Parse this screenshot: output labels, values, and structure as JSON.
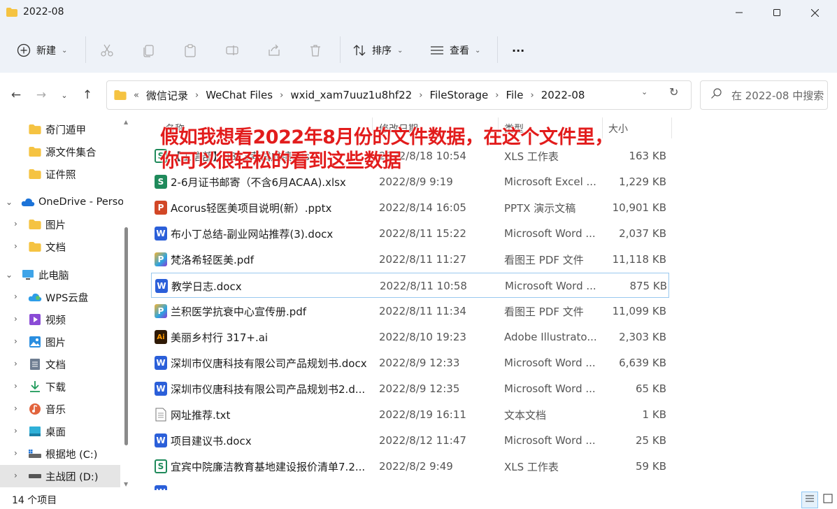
{
  "window": {
    "title": "2022-08"
  },
  "toolbar": {
    "new_label": "新建",
    "sort_label": "排序",
    "view_label": "查看",
    "more_label": "···"
  },
  "address": {
    "overflow": "«",
    "crumbs": [
      "微信记录",
      "WeChat Files",
      "wxid_xam7uuz1u8hf22",
      "FileStorage",
      "File",
      "2022-08"
    ],
    "search_placeholder": "在 2022-08 中搜索"
  },
  "sidebar": {
    "items": [
      {
        "label": "奇门遁甲",
        "icon": "folder-icon"
      },
      {
        "label": "源文件集合",
        "icon": "folder-icon"
      },
      {
        "label": "证件照",
        "icon": "folder-icon"
      },
      {
        "label": "OneDrive - Perso",
        "icon": "cloud-icon"
      },
      {
        "label": "图片",
        "icon": "folder-icon"
      },
      {
        "label": "文档",
        "icon": "folder-icon"
      },
      {
        "label": "此电脑",
        "icon": "computer-icon"
      },
      {
        "label": "WPS云盘",
        "icon": "wps-cloud-icon"
      },
      {
        "label": "视频",
        "icon": "video-icon"
      },
      {
        "label": "图片",
        "icon": "picture-icon"
      },
      {
        "label": "文档",
        "icon": "document-icon"
      },
      {
        "label": "下载",
        "icon": "download-icon"
      },
      {
        "label": "音乐",
        "icon": "music-icon"
      },
      {
        "label": "桌面",
        "icon": "desktop-icon"
      },
      {
        "label": "根据地 (C:)",
        "icon": "windows-drive-icon"
      },
      {
        "label": "主战团 (D:)",
        "icon": "drive-icon"
      }
    ]
  },
  "columns": {
    "name": "名称",
    "date": "修改日期",
    "type": "类型",
    "size": "大小"
  },
  "files": [
    {
      "name": "【工信部】0813考试成绩.xls",
      "date": "2022/8/18 10:54",
      "type": "XLS 工作表",
      "size": "163 KB",
      "icon": "xls"
    },
    {
      "name": "2-6月证书邮寄（不含6月ACAA).xlsx",
      "date": "2022/8/9 9:19",
      "type": "Microsoft Excel ...",
      "size": "1,229 KB",
      "icon": "xlsx"
    },
    {
      "name": "Acorus轻医美项目说明(新）.pptx",
      "date": "2022/8/14 16:05",
      "type": "PPTX 演示文稿",
      "size": "10,901 KB",
      "icon": "pptx"
    },
    {
      "name": "布小丁总结-副业网站推荐(3).docx",
      "date": "2022/8/11 15:22",
      "type": "Microsoft Word ...",
      "size": "2,037 KB",
      "icon": "docx"
    },
    {
      "name": "梵洛希轻医美.pdf",
      "date": "2022/8/11 11:27",
      "type": "看图王 PDF 文件",
      "size": "11,118 KB",
      "icon": "pdf"
    },
    {
      "name": "教学日志.docx",
      "date": "2022/8/11 10:58",
      "type": "Microsoft Word ...",
      "size": "875 KB",
      "icon": "docx"
    },
    {
      "name": "兰积医学抗衰中心宣传册.pdf",
      "date": "2022/8/11 11:34",
      "type": "看图王 PDF 文件",
      "size": "11,099 KB",
      "icon": "pdf"
    },
    {
      "name": "美丽乡村行 317+.ai",
      "date": "2022/8/10 19:23",
      "type": "Adobe Illustrato...",
      "size": "2,303 KB",
      "icon": "ai"
    },
    {
      "name": "深圳市仪唐科技有限公司产品规划书.docx",
      "date": "2022/8/9 12:33",
      "type": "Microsoft Word ...",
      "size": "6,639 KB",
      "icon": "docx"
    },
    {
      "name": "深圳市仪唐科技有限公司产品规划书2.d...",
      "date": "2022/8/9 12:35",
      "type": "Microsoft Word ...",
      "size": "65 KB",
      "icon": "docx"
    },
    {
      "name": "网址推荐.txt",
      "date": "2022/8/19 16:11",
      "type": "文本文档",
      "size": "1 KB",
      "icon": "txt"
    },
    {
      "name": "项目建议书.docx",
      "date": "2022/8/12 11:47",
      "type": "Microsoft Word ...",
      "size": "25 KB",
      "icon": "docx"
    },
    {
      "name": "宜宾中院廉洁教育基地建设报价清单7.2...",
      "date": "2022/8/2 9:49",
      "type": "XLS 工作表",
      "size": "59 KB",
      "icon": "xls"
    }
  ],
  "overlay_text": {
    "line1": "假如我想看2022年8月份的文件数据，在这个文件里，",
    "line2": "你可以很轻松的看到这些数据"
  },
  "status": {
    "item_count": "14 个项目"
  }
}
